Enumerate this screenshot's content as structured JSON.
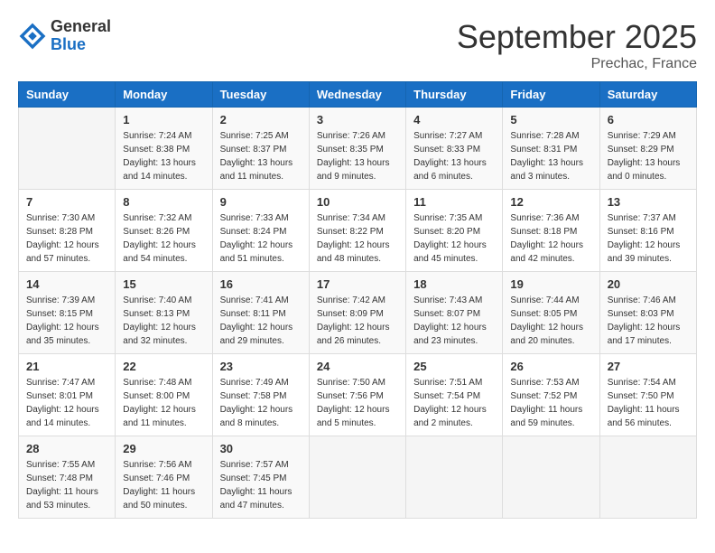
{
  "logo": {
    "line1": "General",
    "line2": "Blue"
  },
  "title": "September 2025",
  "location": "Prechac, France",
  "days_of_week": [
    "Sunday",
    "Monday",
    "Tuesday",
    "Wednesday",
    "Thursday",
    "Friday",
    "Saturday"
  ],
  "weeks": [
    [
      {
        "day": "",
        "info": ""
      },
      {
        "day": "1",
        "info": "Sunrise: 7:24 AM\nSunset: 8:38 PM\nDaylight: 13 hours\nand 14 minutes."
      },
      {
        "day": "2",
        "info": "Sunrise: 7:25 AM\nSunset: 8:37 PM\nDaylight: 13 hours\nand 11 minutes."
      },
      {
        "day": "3",
        "info": "Sunrise: 7:26 AM\nSunset: 8:35 PM\nDaylight: 13 hours\nand 9 minutes."
      },
      {
        "day": "4",
        "info": "Sunrise: 7:27 AM\nSunset: 8:33 PM\nDaylight: 13 hours\nand 6 minutes."
      },
      {
        "day": "5",
        "info": "Sunrise: 7:28 AM\nSunset: 8:31 PM\nDaylight: 13 hours\nand 3 minutes."
      },
      {
        "day": "6",
        "info": "Sunrise: 7:29 AM\nSunset: 8:29 PM\nDaylight: 13 hours\nand 0 minutes."
      }
    ],
    [
      {
        "day": "7",
        "info": "Sunrise: 7:30 AM\nSunset: 8:28 PM\nDaylight: 12 hours\nand 57 minutes."
      },
      {
        "day": "8",
        "info": "Sunrise: 7:32 AM\nSunset: 8:26 PM\nDaylight: 12 hours\nand 54 minutes."
      },
      {
        "day": "9",
        "info": "Sunrise: 7:33 AM\nSunset: 8:24 PM\nDaylight: 12 hours\nand 51 minutes."
      },
      {
        "day": "10",
        "info": "Sunrise: 7:34 AM\nSunset: 8:22 PM\nDaylight: 12 hours\nand 48 minutes."
      },
      {
        "day": "11",
        "info": "Sunrise: 7:35 AM\nSunset: 8:20 PM\nDaylight: 12 hours\nand 45 minutes."
      },
      {
        "day": "12",
        "info": "Sunrise: 7:36 AM\nSunset: 8:18 PM\nDaylight: 12 hours\nand 42 minutes."
      },
      {
        "day": "13",
        "info": "Sunrise: 7:37 AM\nSunset: 8:16 PM\nDaylight: 12 hours\nand 39 minutes."
      }
    ],
    [
      {
        "day": "14",
        "info": "Sunrise: 7:39 AM\nSunset: 8:15 PM\nDaylight: 12 hours\nand 35 minutes."
      },
      {
        "day": "15",
        "info": "Sunrise: 7:40 AM\nSunset: 8:13 PM\nDaylight: 12 hours\nand 32 minutes."
      },
      {
        "day": "16",
        "info": "Sunrise: 7:41 AM\nSunset: 8:11 PM\nDaylight: 12 hours\nand 29 minutes."
      },
      {
        "day": "17",
        "info": "Sunrise: 7:42 AM\nSunset: 8:09 PM\nDaylight: 12 hours\nand 26 minutes."
      },
      {
        "day": "18",
        "info": "Sunrise: 7:43 AM\nSunset: 8:07 PM\nDaylight: 12 hours\nand 23 minutes."
      },
      {
        "day": "19",
        "info": "Sunrise: 7:44 AM\nSunset: 8:05 PM\nDaylight: 12 hours\nand 20 minutes."
      },
      {
        "day": "20",
        "info": "Sunrise: 7:46 AM\nSunset: 8:03 PM\nDaylight: 12 hours\nand 17 minutes."
      }
    ],
    [
      {
        "day": "21",
        "info": "Sunrise: 7:47 AM\nSunset: 8:01 PM\nDaylight: 12 hours\nand 14 minutes."
      },
      {
        "day": "22",
        "info": "Sunrise: 7:48 AM\nSunset: 8:00 PM\nDaylight: 12 hours\nand 11 minutes."
      },
      {
        "day": "23",
        "info": "Sunrise: 7:49 AM\nSunset: 7:58 PM\nDaylight: 12 hours\nand 8 minutes."
      },
      {
        "day": "24",
        "info": "Sunrise: 7:50 AM\nSunset: 7:56 PM\nDaylight: 12 hours\nand 5 minutes."
      },
      {
        "day": "25",
        "info": "Sunrise: 7:51 AM\nSunset: 7:54 PM\nDaylight: 12 hours\nand 2 minutes."
      },
      {
        "day": "26",
        "info": "Sunrise: 7:53 AM\nSunset: 7:52 PM\nDaylight: 11 hours\nand 59 minutes."
      },
      {
        "day": "27",
        "info": "Sunrise: 7:54 AM\nSunset: 7:50 PM\nDaylight: 11 hours\nand 56 minutes."
      }
    ],
    [
      {
        "day": "28",
        "info": "Sunrise: 7:55 AM\nSunset: 7:48 PM\nDaylight: 11 hours\nand 53 minutes."
      },
      {
        "day": "29",
        "info": "Sunrise: 7:56 AM\nSunset: 7:46 PM\nDaylight: 11 hours\nand 50 minutes."
      },
      {
        "day": "30",
        "info": "Sunrise: 7:57 AM\nSunset: 7:45 PM\nDaylight: 11 hours\nand 47 minutes."
      },
      {
        "day": "",
        "info": ""
      },
      {
        "day": "",
        "info": ""
      },
      {
        "day": "",
        "info": ""
      },
      {
        "day": "",
        "info": ""
      }
    ]
  ]
}
